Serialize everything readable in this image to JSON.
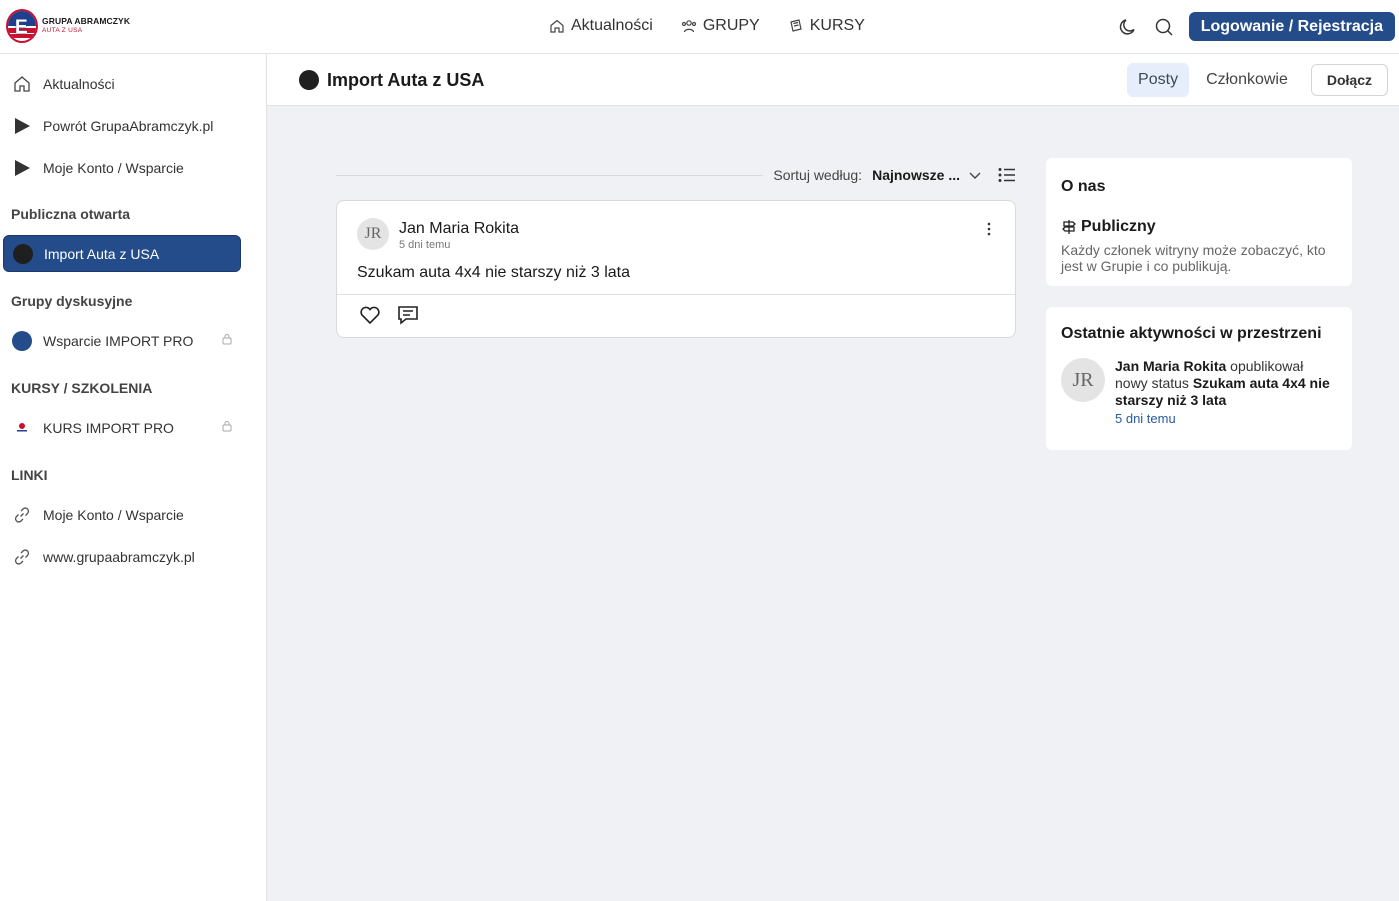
{
  "logo": {
    "line1": "GRUPA ABRAMCZYK",
    "line2": "AUTA Z USA"
  },
  "nav": [
    {
      "label": "Aktualności",
      "icon": "home-icon"
    },
    {
      "label": "GRUPY",
      "icon": "users-icon"
    },
    {
      "label": "KURSY",
      "icon": "courses-icon"
    }
  ],
  "top_right": {
    "login_label": "Logowanie / Rejestracja",
    "theme_icon": "moon-icon",
    "search_icon": "search-icon"
  },
  "colors": {
    "accent": "#244c8b",
    "background": "#f0f1f4",
    "link": "#2a5aa0"
  },
  "sidebar": {
    "items": [
      {
        "label": "Aktualności",
        "icon": "home-icon"
      },
      {
        "label": "Powrót GrupaAbramczyk.pl",
        "icon": "play-icon"
      },
      {
        "label": "Moje Konto / Wsparcie",
        "icon": "play-icon"
      }
    ],
    "sections": [
      {
        "heading": "Publiczna otwarta",
        "items": [
          {
            "label": "Import Auta z USA",
            "active": true
          }
        ]
      },
      {
        "heading": "Grupy dyskusyjne",
        "items": [
          {
            "label": "Wsparcie IMPORT PRO",
            "locked": true
          }
        ]
      },
      {
        "heading": "KURSY / SZKOLENIA",
        "items": [
          {
            "label": "KURS IMPORT PRO",
            "locked": true
          }
        ]
      },
      {
        "heading": "LINKI",
        "items": [
          {
            "label": "Moje Konto / Wsparcie",
            "icon": "link-icon"
          },
          {
            "label": "www.grupaabramczyk.pl",
            "icon": "link-icon"
          }
        ]
      }
    ]
  },
  "group": {
    "title": "Import Auta z USA",
    "tabs": [
      {
        "label": "Posty",
        "active": true
      },
      {
        "label": "Członkowie"
      }
    ],
    "join_label": "Dołącz"
  },
  "feed": {
    "sort_label": "Sortuj według:",
    "sort_value": "Najnowsze ...",
    "posts": [
      {
        "initials": "JR",
        "author": "Jan Maria Rokita",
        "time": "5 dni temu",
        "body": "Szukam auta 4x4 nie starszy niż 3 lata"
      }
    ]
  },
  "about": {
    "title": "O nas",
    "visibility": "Publiczny",
    "description": "Każdy członek witryny może zobaczyć, kto jest w Grupie i co publikują."
  },
  "activity": {
    "title": "Ostatnie aktywności w przestrzeni",
    "initials": "JR",
    "actor": "Jan Maria Rokita",
    "verb": "opublikował nowy status",
    "object": "Szukam auta 4x4 nie starszy niż 3 lata",
    "time": "5 dni temu"
  }
}
